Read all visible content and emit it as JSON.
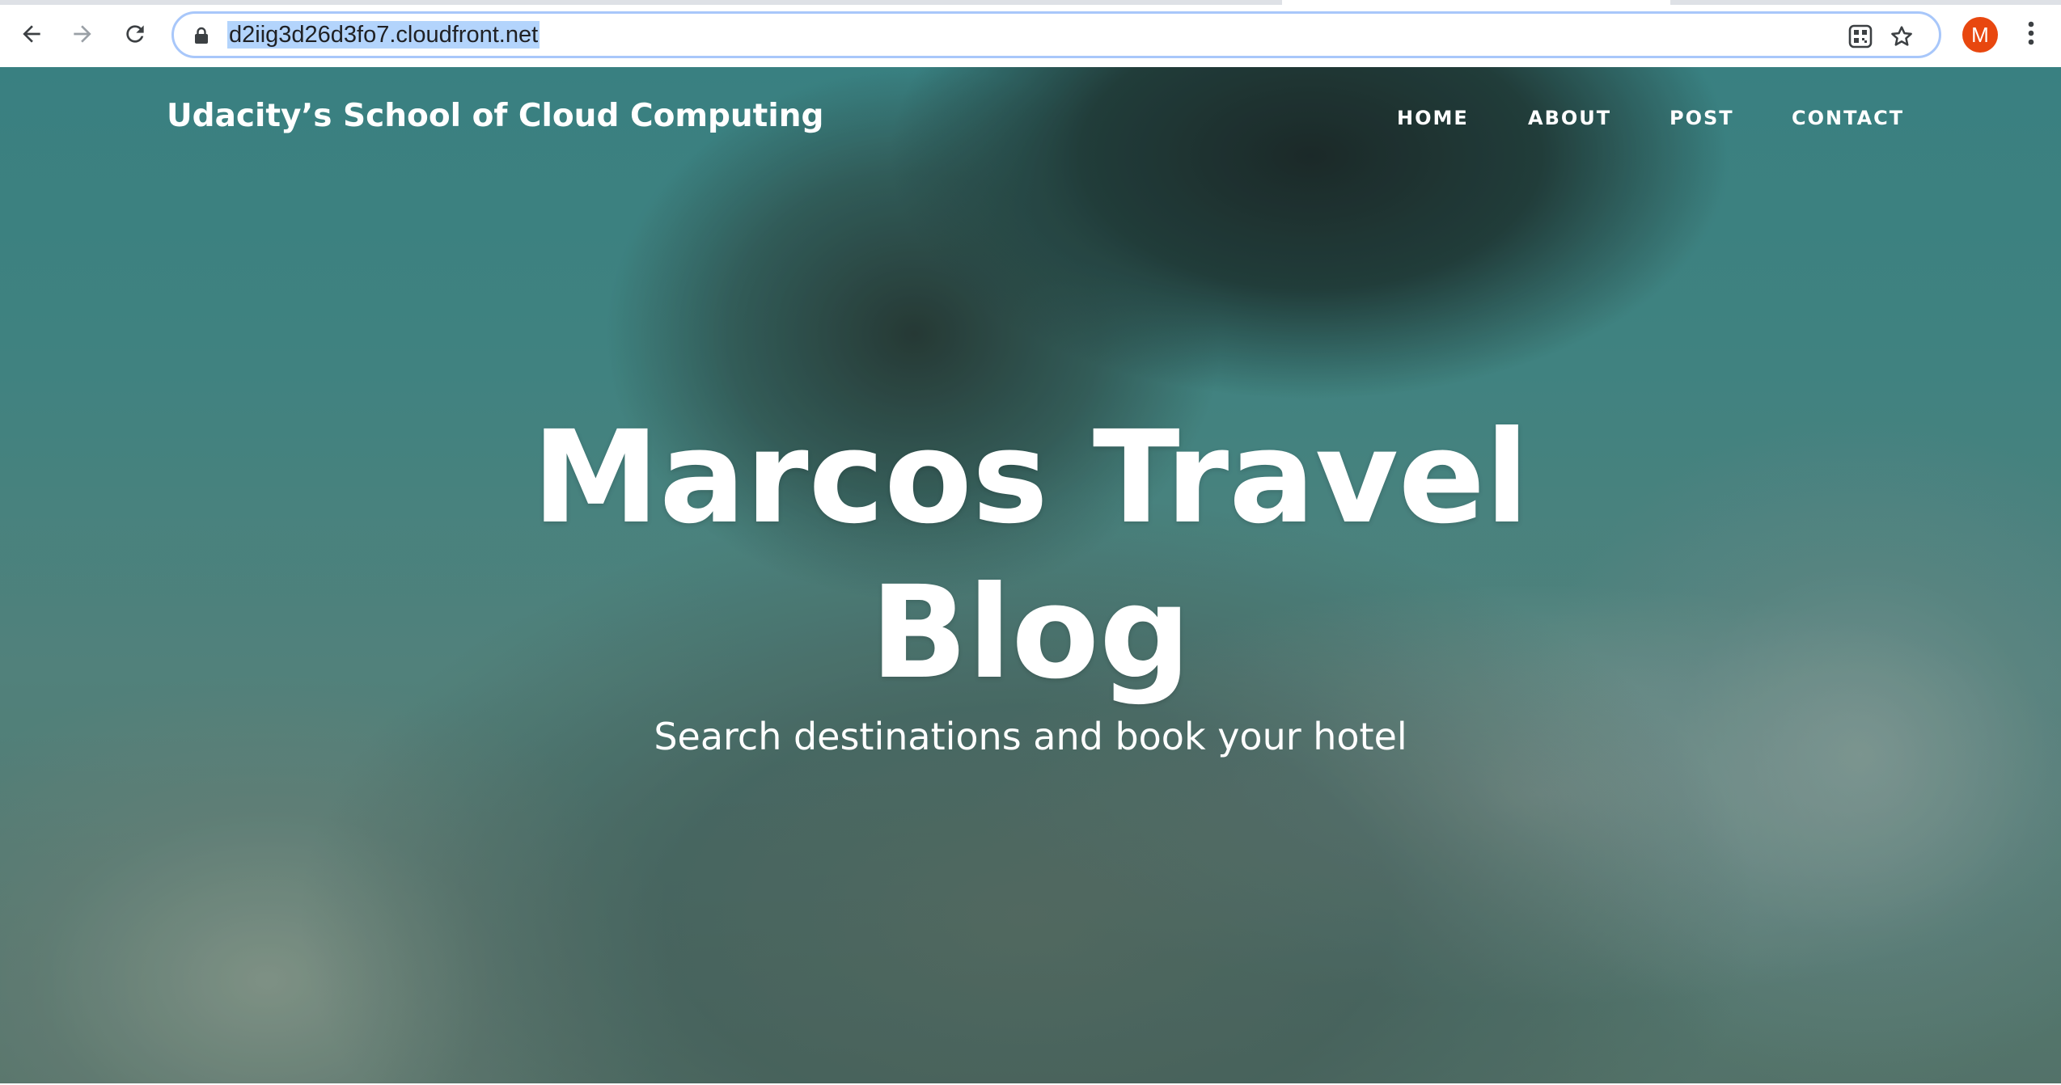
{
  "browser": {
    "url": "d2iig3d26d3fo7.cloudfront.net",
    "profile_initial": "M",
    "icons": {
      "back": "arrow-left-icon",
      "forward": "arrow-right-icon",
      "reload": "reload-icon",
      "lock": "lock-icon",
      "qr": "qr-code-icon",
      "bookmark": "star-icon",
      "menu": "vertical-dots-icon"
    },
    "colors": {
      "omnibox_border": "#a8c7fa",
      "url_selection": "#b3d4fc",
      "avatar": "#e8470f"
    }
  },
  "site": {
    "brand": "Udacity’s School of Cloud Computing",
    "nav": {
      "home": "HOME",
      "about": "ABOUT",
      "post": "POST",
      "contact": "CONTACT"
    }
  },
  "hero": {
    "title": "Marcos Travel Blog",
    "subtitle": "Search destinations and book your hotel"
  }
}
